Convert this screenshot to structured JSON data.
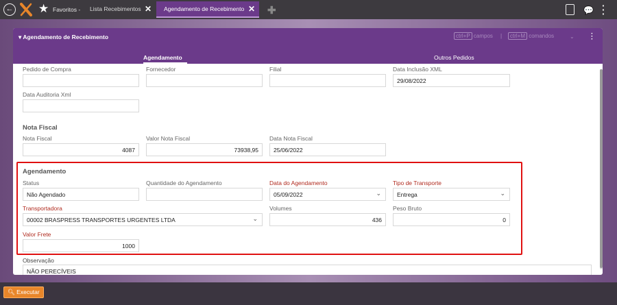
{
  "topbar": {
    "favorites_label": "Favoritos",
    "favorites_sep": "-",
    "tabs": [
      {
        "label": "Lista Recebimentos",
        "close": "✕"
      },
      {
        "label": "Agendamento de Recebimento",
        "close": "✕"
      }
    ],
    "new_tab": "✚"
  },
  "window": {
    "title": "Agendamento de Recebimento",
    "shortcut_fields_key": "ctrl+P",
    "shortcut_fields_label": "campos",
    "shortcut_sep": "|",
    "shortcut_commands_key": "ctrl+M",
    "shortcut_commands_label": "comandos",
    "subtabs": [
      "Agendamento",
      "Outros Pedidos"
    ]
  },
  "form": {
    "pedido_compra": {
      "label": "Pedido de Compra",
      "value": ""
    },
    "fornecedor": {
      "label": "Fornecedor",
      "value": ""
    },
    "filial": {
      "label": "Filial",
      "value": ""
    },
    "data_inclusao_xml": {
      "label": "Data Inclusão XML",
      "value": "29/08/2022"
    },
    "data_auditoria_xml": {
      "label": "Data Auditoria Xml",
      "value": ""
    },
    "nota_fiscal_section": "Nota Fiscal",
    "nota_fiscal": {
      "label": "Nota Fiscal",
      "value": "4087"
    },
    "valor_nota_fiscal": {
      "label": "Valor Nota Fiscal",
      "value": "73938,95"
    },
    "data_nota_fiscal": {
      "label": "Data Nota Fiscal",
      "value": "25/06/2022"
    },
    "agendamento_section": "Agendamento",
    "status": {
      "label": "Status",
      "value": "Não Agendado"
    },
    "quantidade_agendamento": {
      "label": "Quantidade do Agendamento",
      "value": ""
    },
    "data_agendamento": {
      "label": "Data do Agendamento",
      "value": "05/09/2022"
    },
    "tipo_transporte": {
      "label": "Tipo de Transporte",
      "value": "Entrega"
    },
    "transportadora": {
      "label": "Transportadora",
      "value": "00002 BRASPRESS TRANSPORTES URGENTES LTDA"
    },
    "volumes": {
      "label": "Volumes",
      "value": "436"
    },
    "peso_bruto": {
      "label": "Peso Bruto",
      "value": "0"
    },
    "valor_frete": {
      "label": "Valor Frete",
      "value": "1000"
    },
    "observacao": {
      "label": "Observação",
      "value": "NÃO PERECÍVEIS"
    }
  },
  "footer": {
    "execute_label": "Executar"
  },
  "colors": {
    "accent": "#6b3a8a",
    "required": "#b02a1e",
    "highlight": "#e01010",
    "execute": "#e8862a"
  }
}
